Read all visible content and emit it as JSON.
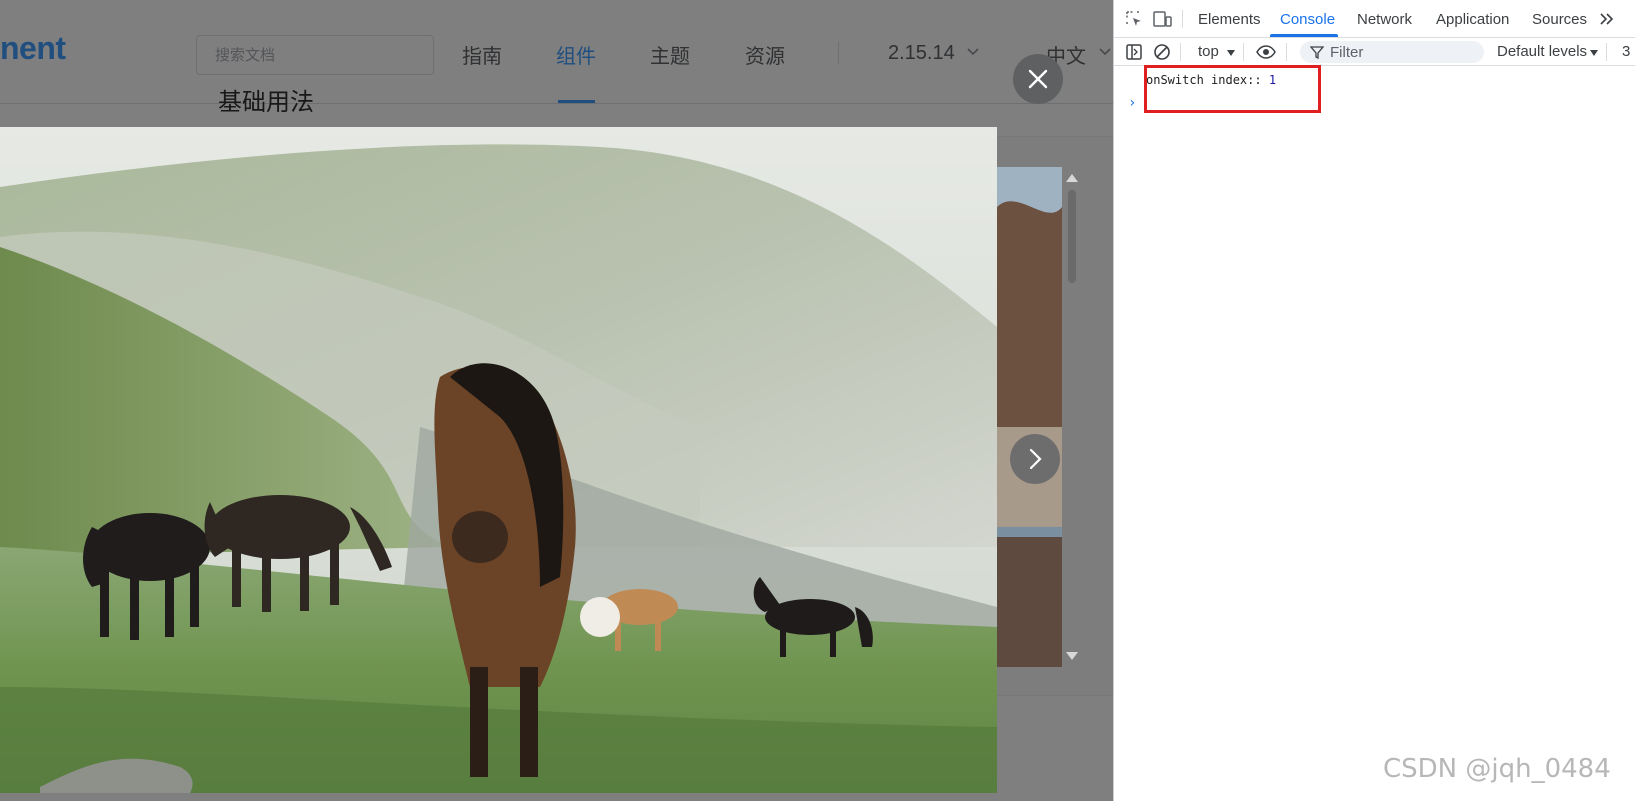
{
  "site": {
    "logo_text": "nent",
    "search_placeholder": "搜索文档",
    "nav": [
      "指南",
      "组件",
      "主题",
      "资源"
    ],
    "active_nav_index": 1,
    "version": "2.15.14",
    "language": "中文",
    "section_title": "基础用法"
  },
  "viewer": {
    "image_subject": "horses-grazing-on-mountain-meadow",
    "close_icon": "close-icon",
    "next_icon": "chevron-right-icon"
  },
  "devtools": {
    "tabs": [
      "Elements",
      "Console",
      "Network",
      "Application",
      "Sources"
    ],
    "active_tab": "Console",
    "more_tabs_icon": "double-chevron-icon",
    "toolbar": {
      "context": "top",
      "filter_placeholder": "Filter",
      "levels": "Default levels",
      "issues_count": "3"
    },
    "console": {
      "messages": [
        {
          "text": "onSwitch index::",
          "value": "1"
        }
      ],
      "prompt": "›"
    }
  },
  "watermark": "CSDN @jqh_0484"
}
